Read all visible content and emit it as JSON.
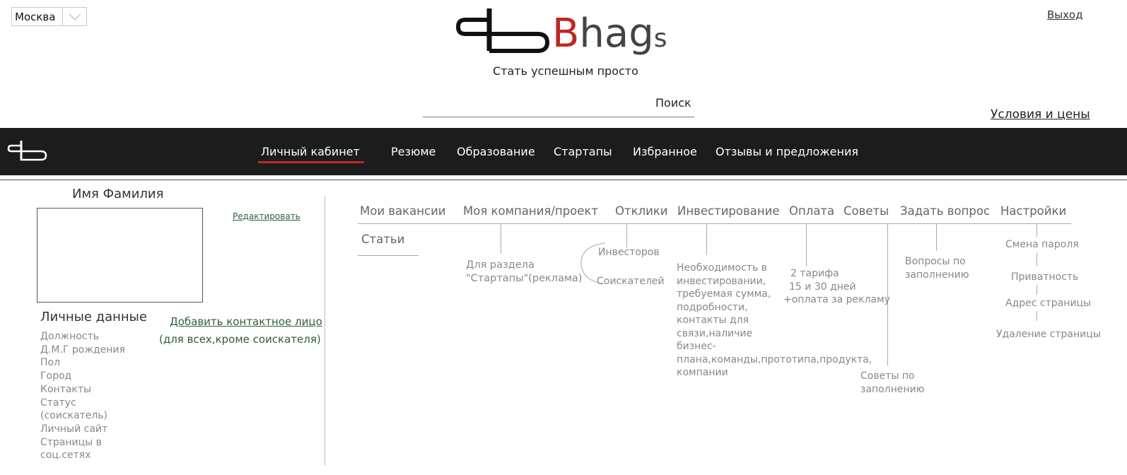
{
  "header": {
    "city": "Москва",
    "logo_text": {
      "first": "B",
      "middle": "hag",
      "last": "s"
    },
    "tagline": "Стать успешным просто",
    "logout": "Выход",
    "search_label": "Поиск",
    "terms_link": "Условия и цены"
  },
  "nav": {
    "items": [
      "Личный кабинет",
      "Резюме",
      "Образование",
      "Стартапы",
      "Избранное",
      "Отзывы и предложения"
    ],
    "active_index": 0,
    "accent_color": "#c0271f"
  },
  "profile": {
    "name": "Имя Фамилия",
    "edit_link": "Редактировать",
    "personal_title": "Личные данные",
    "add_contact": "Добавить контактное лицо",
    "contact_note": "(для всех,кроме  соискателя)",
    "fields": [
      "Должность",
      "Д.М.Г рождения",
      "Пол",
      "Город",
      "Контакты",
      "Статус (соискатель)",
      "Личный сайт",
      "Страницы в соц.сетях"
    ]
  },
  "tabs": {
    "items": [
      "Мои вакансии",
      "Моя компания/проект",
      "Отклики",
      "Инвестирование",
      "Оплата",
      "Советы",
      "Задать вопрос",
      "Настройки"
    ],
    "second_row": [
      "Статьи"
    ]
  },
  "annotations": {
    "company": "Для раздела \"Стартапы\"(реклама)",
    "responses_investors": "Инвесторов",
    "responses_seekers": "Соискателей",
    "investing": "Необходимость в инвестировании, требуемая сумма, подробности, контакты для связи,наличие бизнес-плана,команды,прототипа,продукта, компании",
    "payment": [
      "2 тарифа",
      "15 и 30 дней",
      "+оплата за рекламу"
    ],
    "advice": "Советы по заполнению",
    "question": "Вопросы по заполнению",
    "settings": [
      "Смена пароля",
      "Приватность",
      "Адрес страницы",
      "Удаление страницы"
    ]
  }
}
